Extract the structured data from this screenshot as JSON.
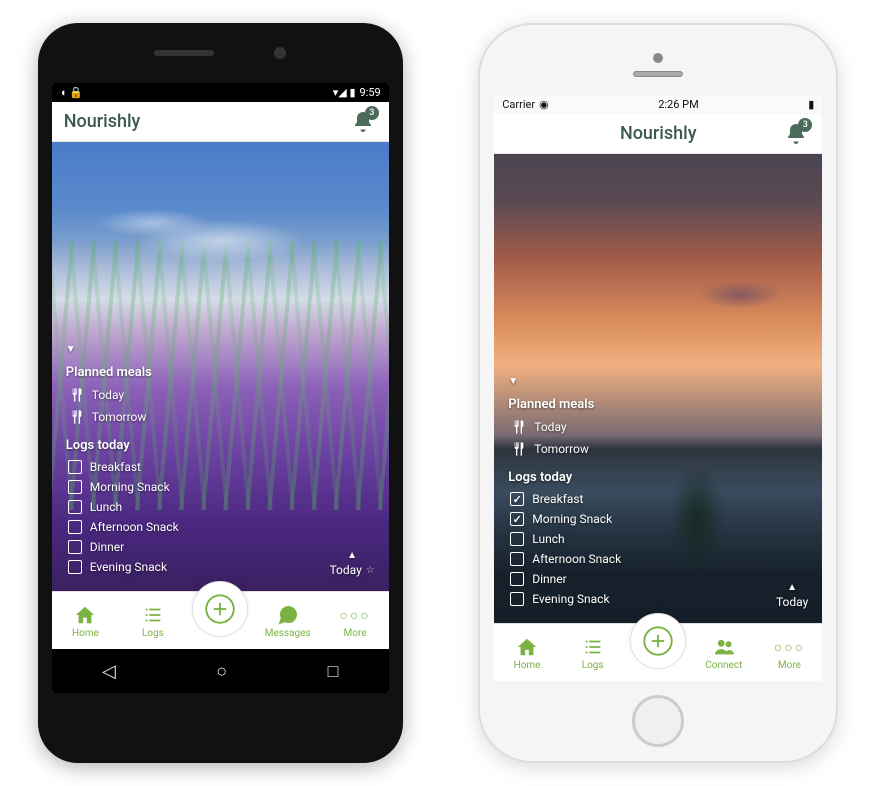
{
  "colors": {
    "accent": "#7ab342",
    "header_text": "#3a5a4a"
  },
  "android": {
    "status": {
      "left_icons": "◖ 🔒",
      "right_icons": "▾◢ ▮",
      "time": "9:59"
    },
    "app_title": "Nourishly",
    "notification_count": "3",
    "planned_meals_header": "Planned meals",
    "planned_meals": [
      {
        "label": "Today"
      },
      {
        "label": "Tomorrow"
      }
    ],
    "logs_header": "Logs today",
    "logs": [
      {
        "label": "Breakfast",
        "checked": false
      },
      {
        "label": "Morning Snack",
        "checked": false
      },
      {
        "label": "Lunch",
        "checked": false
      },
      {
        "label": "Afternoon Snack",
        "checked": false
      },
      {
        "label": "Dinner",
        "checked": false
      },
      {
        "label": "Evening Snack",
        "checked": false
      }
    ],
    "today_label": "Today",
    "tabs": {
      "home": "Home",
      "logs": "Logs",
      "messages": "Messages",
      "more": "More"
    }
  },
  "iphone": {
    "status": {
      "carrier": "Carrier",
      "time": "2:26 PM",
      "battery_icon": "▮"
    },
    "app_title": "Nourishly",
    "notification_count": "3",
    "planned_meals_header": "Planned meals",
    "planned_meals": [
      {
        "label": "Today"
      },
      {
        "label": "Tomorrow"
      }
    ],
    "logs_header": "Logs today",
    "logs": [
      {
        "label": "Breakfast",
        "checked": true
      },
      {
        "label": "Morning Snack",
        "checked": true
      },
      {
        "label": "Lunch",
        "checked": false
      },
      {
        "label": "Afternoon Snack",
        "checked": false
      },
      {
        "label": "Dinner",
        "checked": false
      },
      {
        "label": "Evening Snack",
        "checked": false
      }
    ],
    "today_label": "Today",
    "tabs": {
      "home": "Home",
      "logs": "Logs",
      "connect": "Connect",
      "more": "More"
    }
  }
}
